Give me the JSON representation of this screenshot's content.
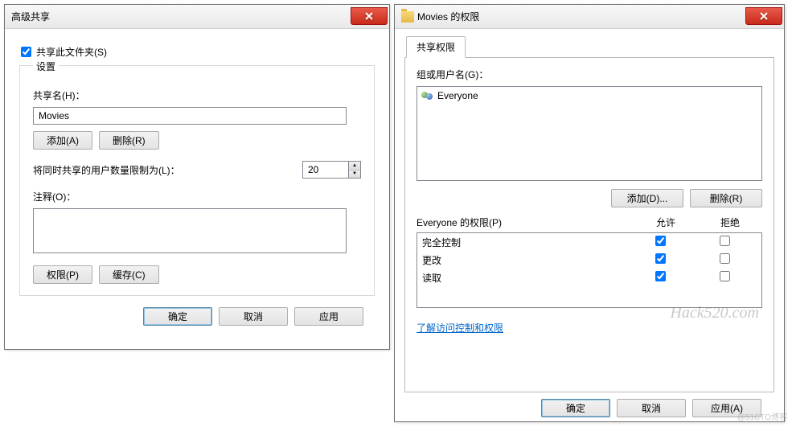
{
  "left_dialog": {
    "title": "高级共享",
    "share_checkbox_label": "共享此文件夹(S)",
    "share_checked": true,
    "settings_legend": "设置",
    "share_name_label": "共享名(H)：",
    "share_name_value": "Movies",
    "add_btn": "添加(A)",
    "remove_btn": "删除(R)",
    "limit_label": "将同时共享的用户数量限制为(L)：",
    "limit_value": "20",
    "comment_label": "注释(O)：",
    "comment_value": "",
    "perm_btn": "权限(P)",
    "cache_btn": "缓存(C)",
    "ok_btn": "确定",
    "cancel_btn": "取消",
    "apply_btn": "应用"
  },
  "right_dialog": {
    "title": "Movies 的权限",
    "tab_label": "共享权限",
    "group_label": "组或用户名(G)：",
    "principal": "Everyone",
    "add_btn": "添加(D)...",
    "remove_btn": "删除(R)",
    "perm_for_label": "Everyone 的权限(P)",
    "allow_label": "允许",
    "deny_label": "拒绝",
    "perms": [
      {
        "name": "完全控制",
        "allow": true,
        "deny": false
      },
      {
        "name": "更改",
        "allow": true,
        "deny": false
      },
      {
        "name": "读取",
        "allow": true,
        "deny": false
      }
    ],
    "learn_link": "了解访问控制和权限",
    "ok_btn": "确定",
    "cancel_btn": "取消",
    "apply_btn": "应用(A)"
  },
  "watermark": "Hack520.com",
  "watermark2": "@51CTO博客"
}
